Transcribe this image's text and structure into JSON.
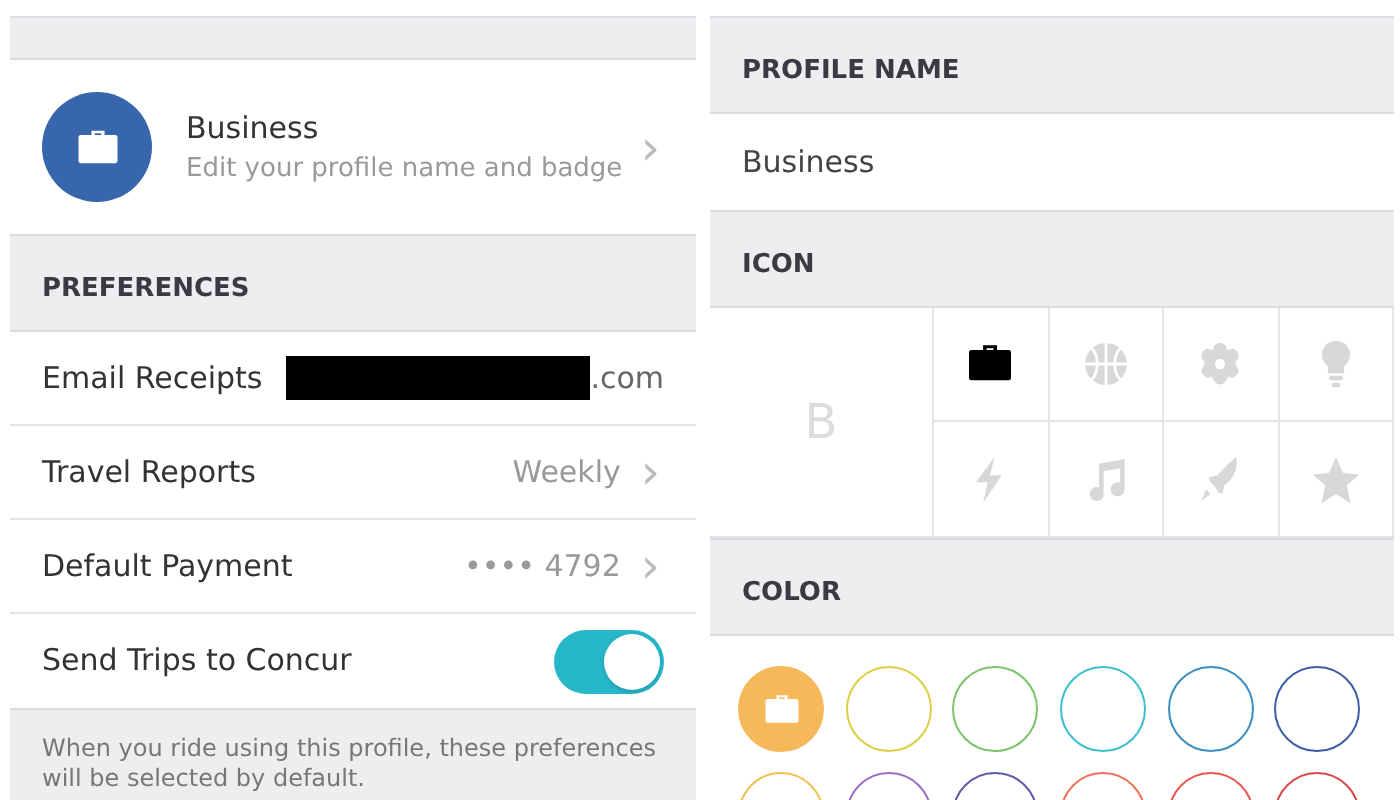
{
  "profile": {
    "name": "Business",
    "subtitle": "Edit your profile name and badge",
    "chevron": "›"
  },
  "preferences": {
    "header": "PREFERENCES",
    "rows": [
      {
        "kind": "redacted",
        "label": "Email Receipts",
        "value": ".com"
      },
      {
        "kind": "link",
        "label": "Travel Reports",
        "value": "Weekly",
        "chevron": "›"
      },
      {
        "kind": "link",
        "label": "Default Payment",
        "value": "•••• 4792",
        "chevron": "›"
      },
      {
        "kind": "toggle",
        "label": "Send Trips to Concur",
        "on": true
      }
    ],
    "footer": "When you ride using this profile, these preferences will be selected by default."
  },
  "profile_name": {
    "header": "PROFILE NAME",
    "value": "Business"
  },
  "icon_section": {
    "header": "ICON",
    "letter": "B",
    "icons": [
      {
        "kind": "briefcase",
        "selected": true
      },
      {
        "kind": "basketball",
        "selected": false
      },
      {
        "kind": "flower",
        "selected": false
      },
      {
        "kind": "bulb",
        "selected": false
      },
      {
        "kind": "bolt",
        "selected": false
      },
      {
        "kind": "music",
        "selected": false
      },
      {
        "kind": "rocket",
        "selected": false
      },
      {
        "kind": "star",
        "selected": false
      }
    ]
  },
  "color_section": {
    "header": "COLOR",
    "colors": [
      {
        "color": "#f5b85a",
        "selected": true
      },
      {
        "color": "#dccf45",
        "selected": false
      },
      {
        "color": "#7cc36a",
        "selected": false
      },
      {
        "color": "#3bbfcf",
        "selected": false
      },
      {
        "color": "#3a8fc0",
        "selected": false
      },
      {
        "color": "#3b5ea8",
        "selected": false
      },
      {
        "color": "#f0c050",
        "selected": false
      },
      {
        "color": "#9b6fc0",
        "selected": false
      },
      {
        "color": "#5a5aa8",
        "selected": false
      },
      {
        "color": "#f07058",
        "selected": false
      },
      {
        "color": "#e85850",
        "selected": false
      },
      {
        "color": "#d84848",
        "selected": false
      }
    ]
  }
}
